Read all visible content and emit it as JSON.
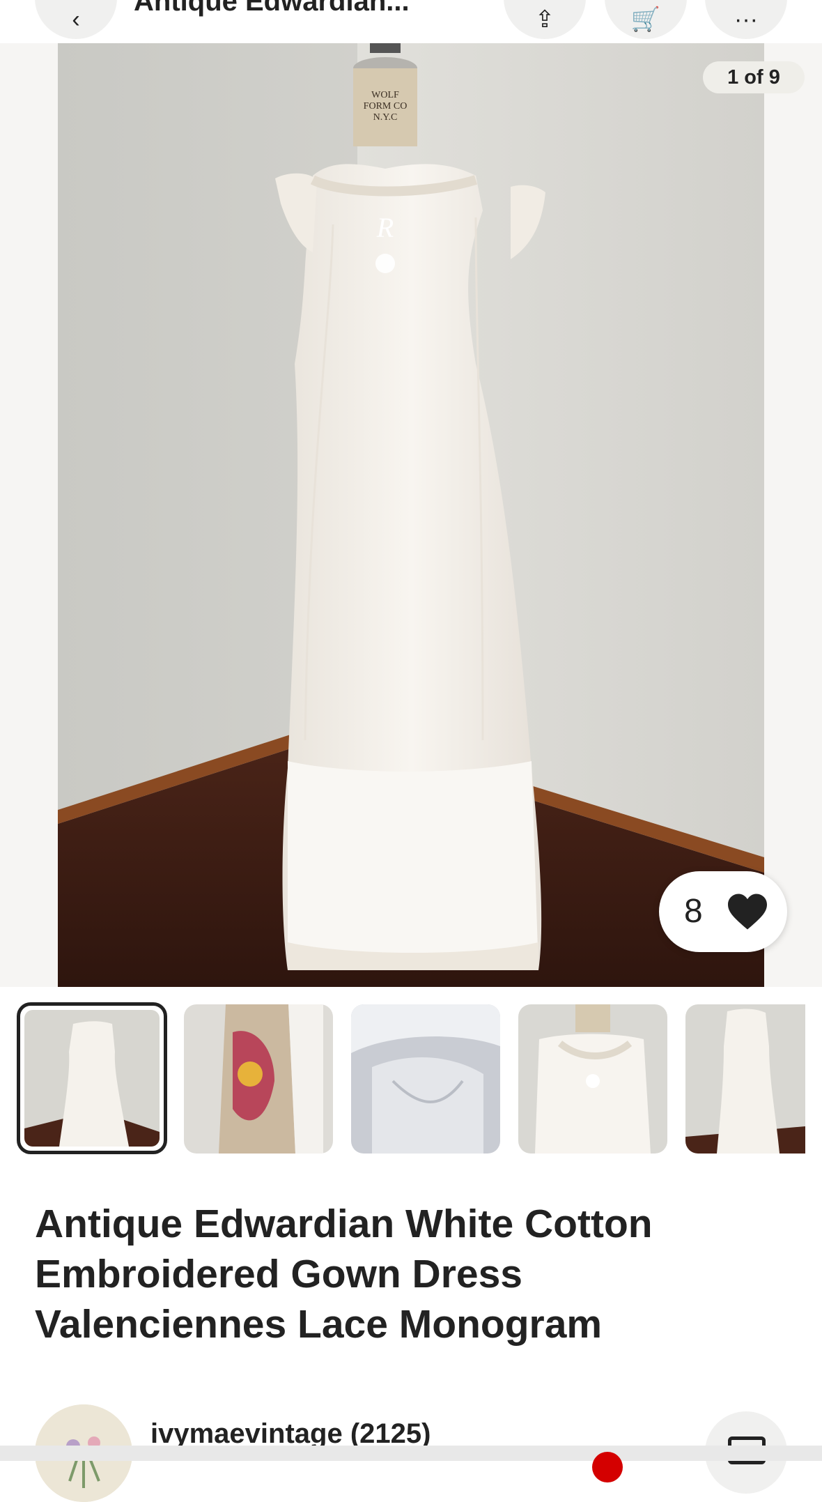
{
  "header": {
    "title": "Antique Edwardian...",
    "back_icon": "chevron-left-icon",
    "share_icon": "share-icon",
    "cart_icon": "cart-icon",
    "more_icon": "more-icon"
  },
  "gallery": {
    "counter": "1 of 9",
    "favorites_count": "8",
    "heart_icon": "heart-icon",
    "thumbnails": [
      {
        "label": "dress front view"
      },
      {
        "label": "dress with floral shawl"
      },
      {
        "label": "bodice detail"
      },
      {
        "label": "neckline lace detail"
      },
      {
        "label": "dress side view"
      }
    ]
  },
  "listing": {
    "title": "Antique Edwardian White Cotton Embroidered Gown Dress Valenciennes Lace Monogram"
  },
  "seller": {
    "name": "ivymaevintage (2125)",
    "message_icon": "message-icon"
  },
  "colors": {
    "text": "#222222",
    "notification": "#d40000",
    "pill_bg": "#efeee9"
  }
}
